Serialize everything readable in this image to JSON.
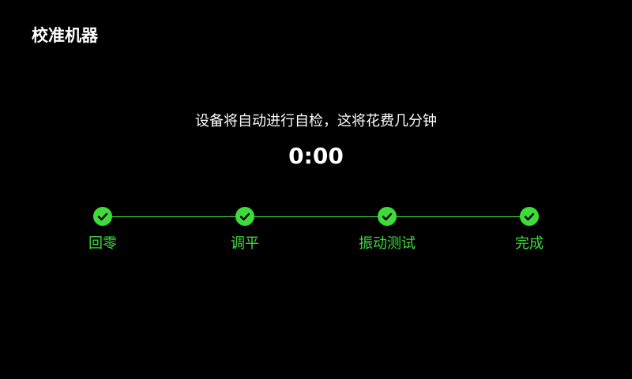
{
  "header": {
    "title": "校准机器"
  },
  "main": {
    "message": "设备将自动进行自检，这将花费几分钟",
    "timer": "0:00"
  },
  "steps": [
    {
      "label": "回零",
      "status": "complete",
      "icon": "check-icon"
    },
    {
      "label": "调平",
      "status": "complete",
      "icon": "check-icon"
    },
    {
      "label": "振动测试",
      "status": "complete",
      "icon": "check-icon"
    },
    {
      "label": "完成",
      "status": "complete",
      "icon": "check-icon"
    }
  ],
  "colors": {
    "background": "#000000",
    "text": "#ffffff",
    "accent": "#3ddc3a"
  }
}
